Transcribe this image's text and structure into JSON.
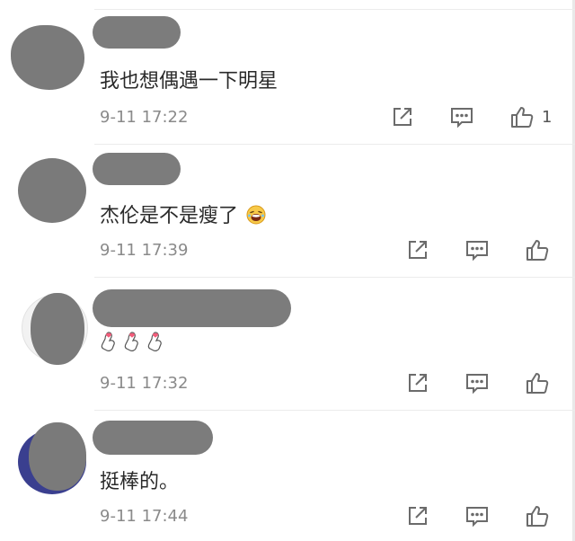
{
  "comments": [
    {
      "text": "我也想偶遇一下明星",
      "time": "9-11 17:22",
      "likes": "1"
    },
    {
      "text": "杰伦是不是瘦了",
      "time": "9-11 17:39",
      "likes": ""
    },
    {
      "text": "",
      "time": "9-11 17:32",
      "likes": ""
    },
    {
      "text": "挺棒的。",
      "time": "9-11 17:44",
      "likes": ""
    }
  ],
  "icons": {
    "share": "share-icon",
    "comment": "comment-icon",
    "like": "thumbs-up-icon",
    "emoji_laugh": "laughing-face-icon",
    "heart_hand": "finger-heart-icon"
  },
  "colors": {
    "redacted": "#7c7c7c",
    "timestamp": "#8a8a8a",
    "icon_stroke": "#6b6b6b",
    "text": "#2a2a2a"
  }
}
